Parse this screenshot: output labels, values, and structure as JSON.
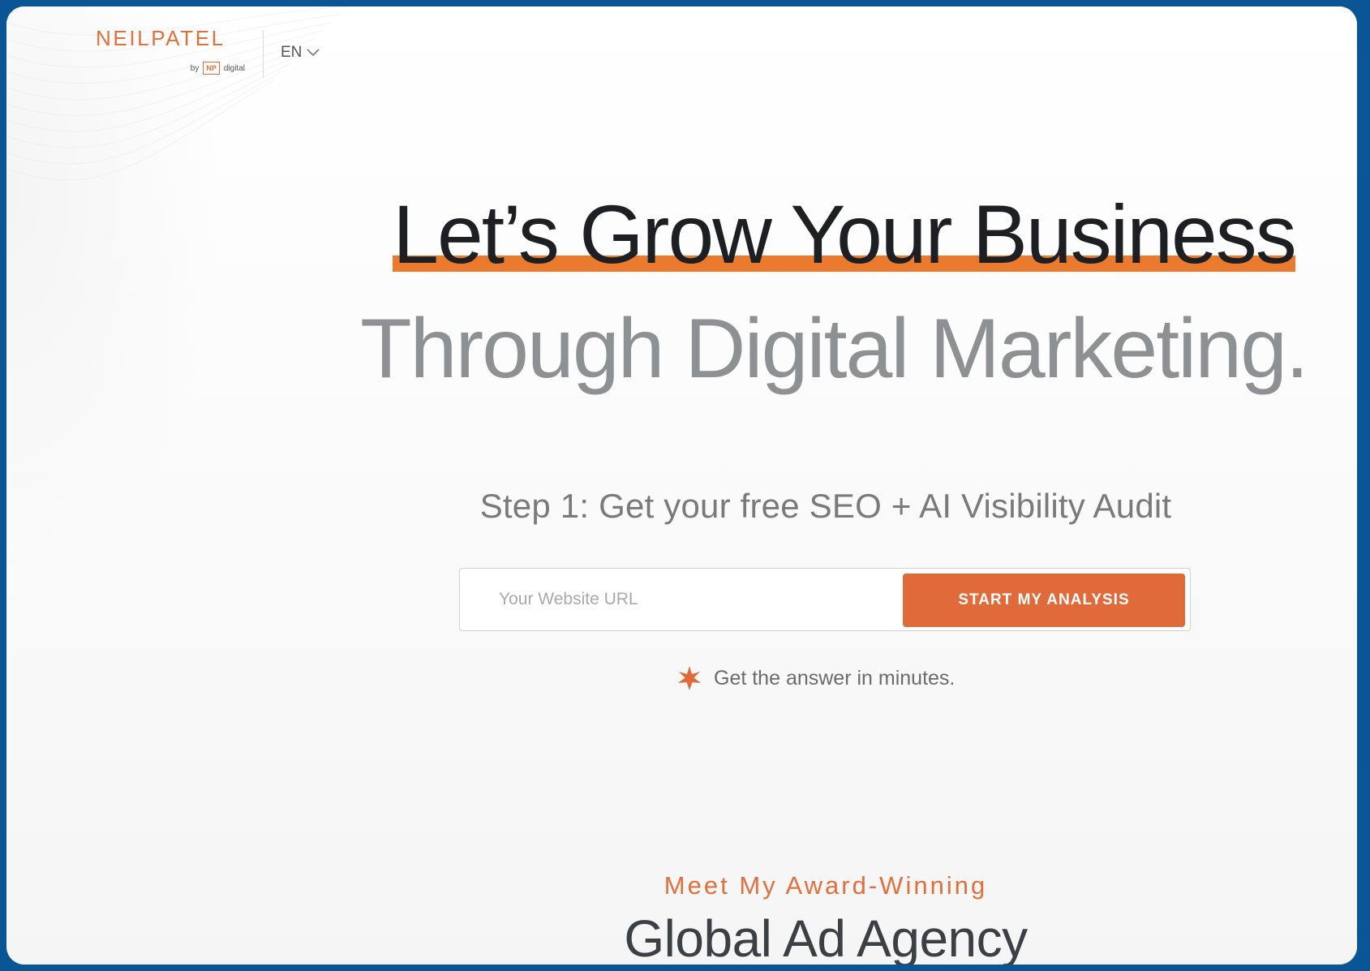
{
  "header": {
    "logo_text": "NEILPATEL",
    "logo_by": "by",
    "logo_badge": "NP",
    "logo_sub": "digital",
    "language": "EN"
  },
  "hero": {
    "headline_line1": "Let’s Grow Your Business",
    "headline_line2": "Through Digital Marketing.",
    "step_title": "Step 1: Get your free SEO + AI Visibility Audit",
    "url_input": {
      "placeholder": "Your Website URL",
      "value": ""
    },
    "cta_label": "START MY ANALYSIS",
    "note": "Get the answer in minutes."
  },
  "agency": {
    "eyebrow": "Meet My Award-Winning",
    "title": "Global Ad Agency"
  },
  "icons": {
    "language_toggle": "chevron-down-icon",
    "note": "star-burst-icon"
  },
  "colors": {
    "accent": "#e16a3b",
    "highlight": "#ea7a2e",
    "frame_border": "#0a5595",
    "headline_dark": "#1d1f22",
    "headline_gray": "#8e9193"
  }
}
